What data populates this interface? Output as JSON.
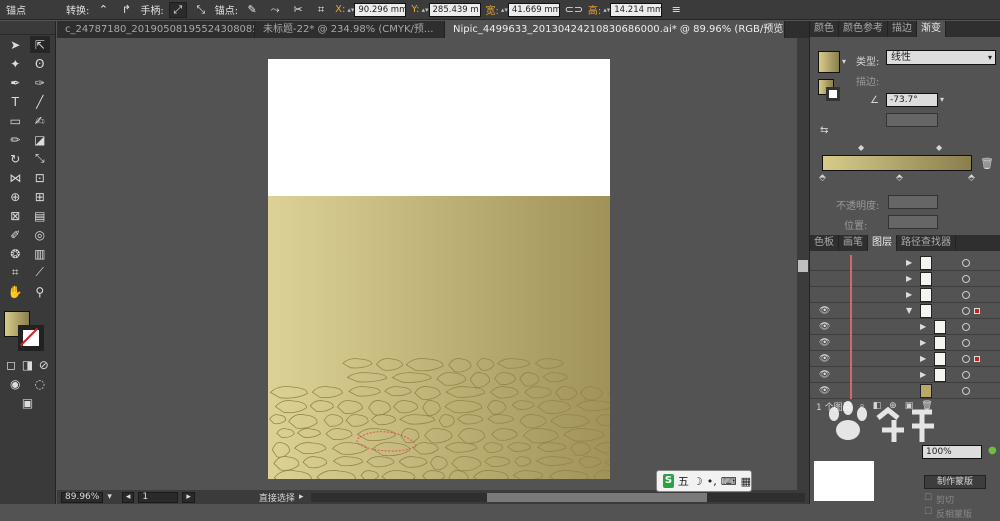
{
  "control_bar": {
    "anchor_label": "锚点",
    "convert_label": "转换:",
    "handle_label": "手柄:",
    "anchors_label": "锚点:",
    "x_label": "X:",
    "x_value": "90.296 mm",
    "y_label": "Y:",
    "y_value": "285.439 m",
    "w_label": "宽:",
    "w_value": "41.669 mm",
    "h_label": "高:",
    "h_value": "14.214 mm"
  },
  "document_tabs": [
    {
      "label": "c_24787180_20190508195524308085.ai*"
    },
    {
      "label": "未标题-22* @ 234.98% (CMYK/预..."
    },
    {
      "label": "Nipic_4499633_20130424210830686000.ai* @ 89.96% (RGB/预览)"
    }
  ],
  "status_bar": {
    "zoom": "89.96%",
    "artboard": "1",
    "tool_name": "直接选择"
  },
  "gradient_panel": {
    "tabs": [
      "颜色",
      "颜色参考",
      "描边",
      "渐变"
    ],
    "type_label": "类型:",
    "type_value": "线性",
    "stroke_label": "描边:",
    "angle_value": "-73.7°",
    "opacity_label": "不透明度:",
    "position_label": "位置:",
    "start_color": "#d8cc8a",
    "end_color": "#8a7e4d"
  },
  "layers_panel": {
    "tabs": [
      "色板",
      "画笔",
      "图层",
      "路径查找器"
    ],
    "footer_text": "1 个图层"
  },
  "transparency_panel": {
    "percent": "100%",
    "make_mask_label": "制作蒙版",
    "clip_label": "剪切",
    "invert_label": "反相蒙版"
  },
  "taskbar": {
    "ime_label": "五"
  },
  "colors": {
    "accent": "#e8a43a",
    "layer_color": "#d06a6a"
  }
}
